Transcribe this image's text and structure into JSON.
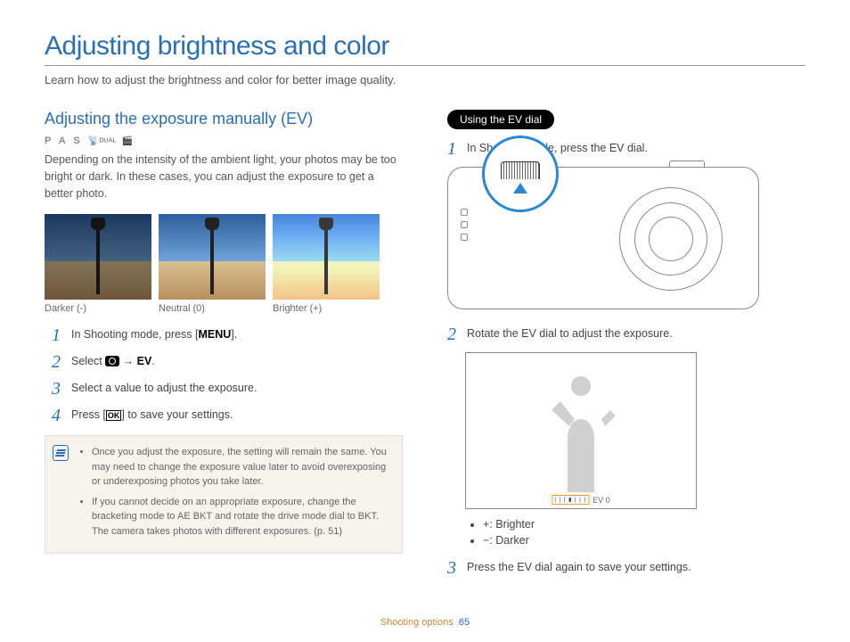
{
  "page_title": "Adjusting brightness and color",
  "intro": "Learn how to adjust the brightness and color for better image quality.",
  "left": {
    "section_title": "Adjusting the exposure manually (EV)",
    "modes": "P A S",
    "modes_extra": "DUAL",
    "desc": "Depending on the intensity of the ambient light, your photos may be too bright or dark. In these cases, you can adjust the exposure to get a better photo.",
    "samples": [
      {
        "caption": "Darker (-)"
      },
      {
        "caption": "Neutral (0)"
      },
      {
        "caption": "Brighter (+)"
      }
    ],
    "steps": [
      {
        "num": "1",
        "text_before": "In Shooting mode, press [",
        "bold": "MENU",
        "text_after": "]."
      },
      {
        "num": "2",
        "text_before": "Select ",
        "icon": true,
        "arrow": " → ",
        "bold": "EV",
        "text_after": "."
      },
      {
        "num": "3",
        "text_before": "Select a value to adjust the exposure.",
        "bold": "",
        "text_after": ""
      },
      {
        "num": "4",
        "text_before": "Press [",
        "icon_ok": true,
        "text_after": "] to save your settings."
      }
    ],
    "note": {
      "items": [
        "Once you adjust the exposure, the setting will remain the same. You may need to change the exposure value later to avoid overexposing or underexposing photos you take later.",
        "If you cannot decide on an appropriate exposure, change the bracketing mode to AE BKT and rotate the drive mode dial to BKT. The camera takes photos with different exposures. (p. 51)"
      ]
    }
  },
  "right": {
    "pill": "Using the EV dial",
    "step1": "In Shooting mode, press the EV dial.",
    "step2": "Rotate the EV dial to adjust the exposure.",
    "ev_label": "EV 0",
    "bullets": [
      "+: Brighter",
      "−: Darker"
    ],
    "step3": "Press the EV dial again to save your settings."
  },
  "footer": {
    "section": "Shooting options",
    "page": "65"
  }
}
